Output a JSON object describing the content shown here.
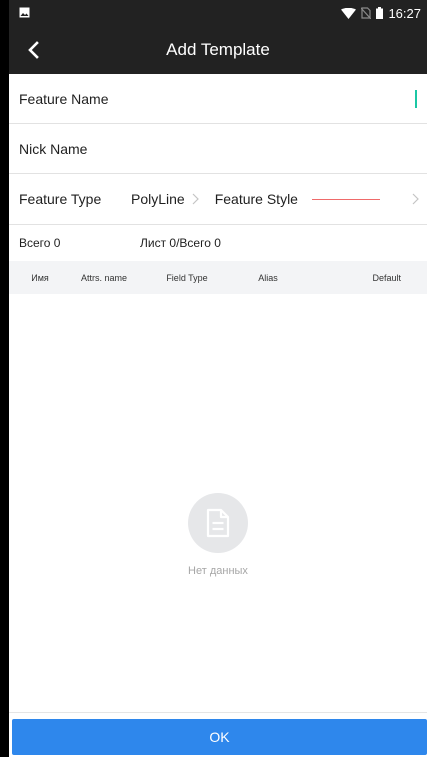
{
  "status_bar": {
    "time": "16:27",
    "icons": [
      "image-icon",
      "wifi-icon",
      "no-sim-icon",
      "battery-icon"
    ]
  },
  "toolbar": {
    "title": "Add Template",
    "back_icon": "chevron-left-icon"
  },
  "form": {
    "feature_name_label": "Feature Name",
    "nick_name_label": "Nick Name",
    "feature_type_label": "Feature Type",
    "feature_type_value": "PolyLine",
    "feature_style_label": "Feature Style",
    "feature_style_color": "#ef6a6a"
  },
  "summary": {
    "total": "Всего 0",
    "page": "Лист 0/Всего 0"
  },
  "table": {
    "columns": [
      "Имя",
      "Attrs. name",
      "Field Type",
      "Alias",
      "Default"
    ]
  },
  "empty_state": {
    "icon": "document-icon",
    "text": "Нет данных"
  },
  "footer": {
    "ok_label": "OK"
  },
  "colors": {
    "bar": "#222222",
    "accent": "#2e87ec",
    "cursor": "#1bc7a4"
  }
}
